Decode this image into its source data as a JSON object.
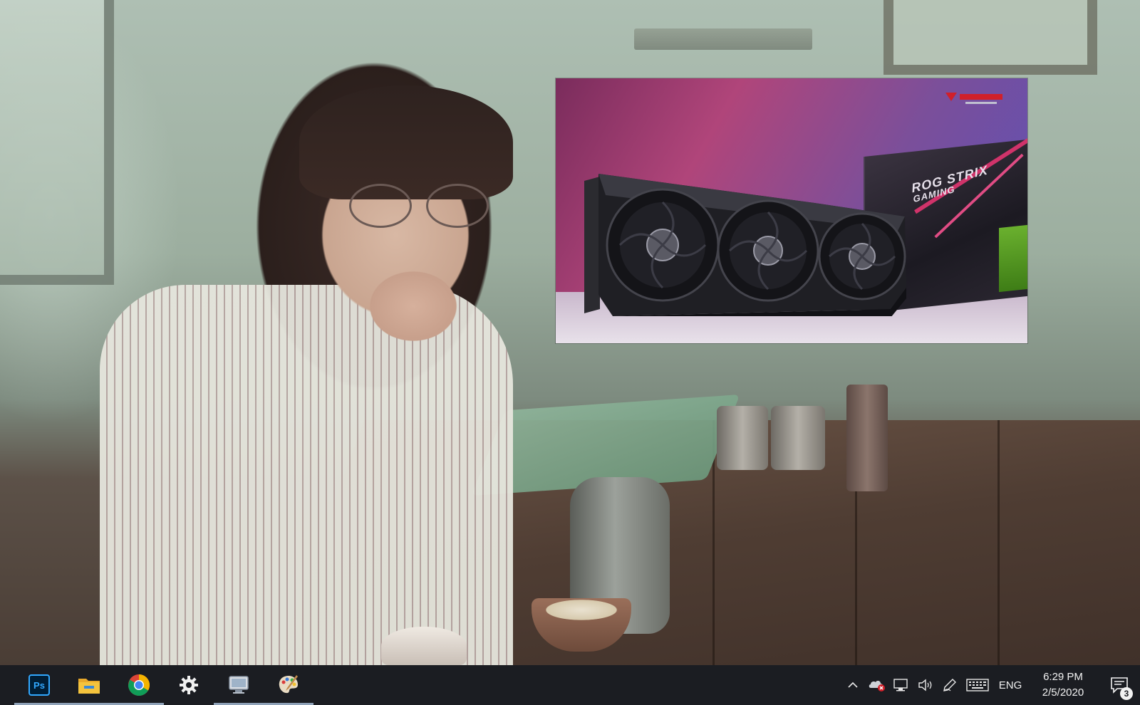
{
  "taskbar": {
    "pinned_apps": [
      {
        "name": "Adobe Photoshop",
        "icon": "photoshop-icon",
        "label": "Ps",
        "running": true
      },
      {
        "name": "File Explorer",
        "icon": "file-explorer-icon",
        "running": true
      },
      {
        "name": "Google Chrome",
        "icon": "chrome-icon",
        "running": true
      },
      {
        "name": "Settings",
        "icon": "gear-icon",
        "running": false
      },
      {
        "name": "Remote Desktop",
        "icon": "remote-desktop-icon",
        "running": true
      },
      {
        "name": "Paint",
        "icon": "paint-palette-icon",
        "running": true
      }
    ],
    "tray": {
      "language": "ENG",
      "time": "6:29 PM",
      "date": "2/5/2020",
      "notification_count": "3"
    },
    "colors": {
      "background": "#1b1d22",
      "running_indicator": "#8fa2b8",
      "photoshop_blue": "#31a8ff",
      "folder_yellow": "#f4c33d"
    }
  },
  "pip_overlay": {
    "box_title_line1": "ROG STRIX",
    "box_title_line2": "GAMING",
    "accent_colors": {
      "pink": "#b0457a",
      "purple": "#5a50b8",
      "nvidia_green": "#6ab02e",
      "logo_red": "#d0202a"
    }
  }
}
